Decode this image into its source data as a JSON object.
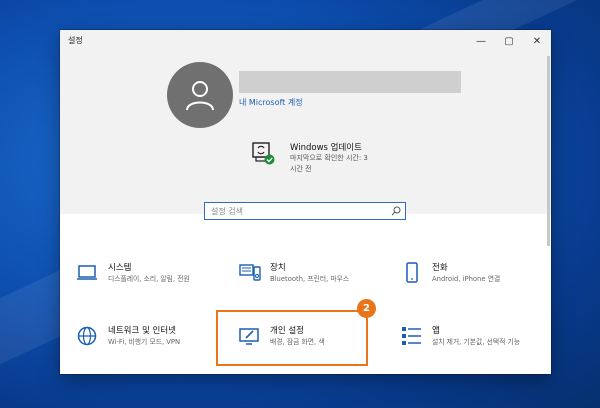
{
  "window": {
    "title": "설정",
    "minimize": "—",
    "maximize": "▢",
    "close": "✕"
  },
  "account": {
    "link": "내 Microsoft 계정"
  },
  "update": {
    "title": "Windows 업데이트",
    "subtitle": "마지막으로 확인한 시간: 3시간 전"
  },
  "search": {
    "placeholder": "설정 검색"
  },
  "tiles": [
    {
      "title": "시스템",
      "subtitle": "디스플레이, 소리, 알림, 전원",
      "icon": "laptop-icon"
    },
    {
      "title": "장치",
      "subtitle": "Bluetooth, 프린터, 마우스",
      "icon": "keyboard-icon"
    },
    {
      "title": "전화",
      "subtitle": "Android, iPhone 연결",
      "icon": "phone-icon"
    },
    {
      "title": "네트워크 및 인터넷",
      "subtitle": "Wi-Fi, 비행기 모드, VPN",
      "icon": "globe-icon"
    },
    {
      "title": "개인 설정",
      "subtitle": "배경, 잠금 화면, 색",
      "icon": "personalization-icon"
    },
    {
      "title": "앱",
      "subtitle": "설치 제거, 기본값, 선택적 기능",
      "icon": "apps-icon"
    }
  ],
  "annotation": {
    "badge": "2"
  },
  "colors": {
    "accent": "#1b5fb3",
    "highlight": "#e8751a",
    "header_bg": "#f2f2f2"
  }
}
